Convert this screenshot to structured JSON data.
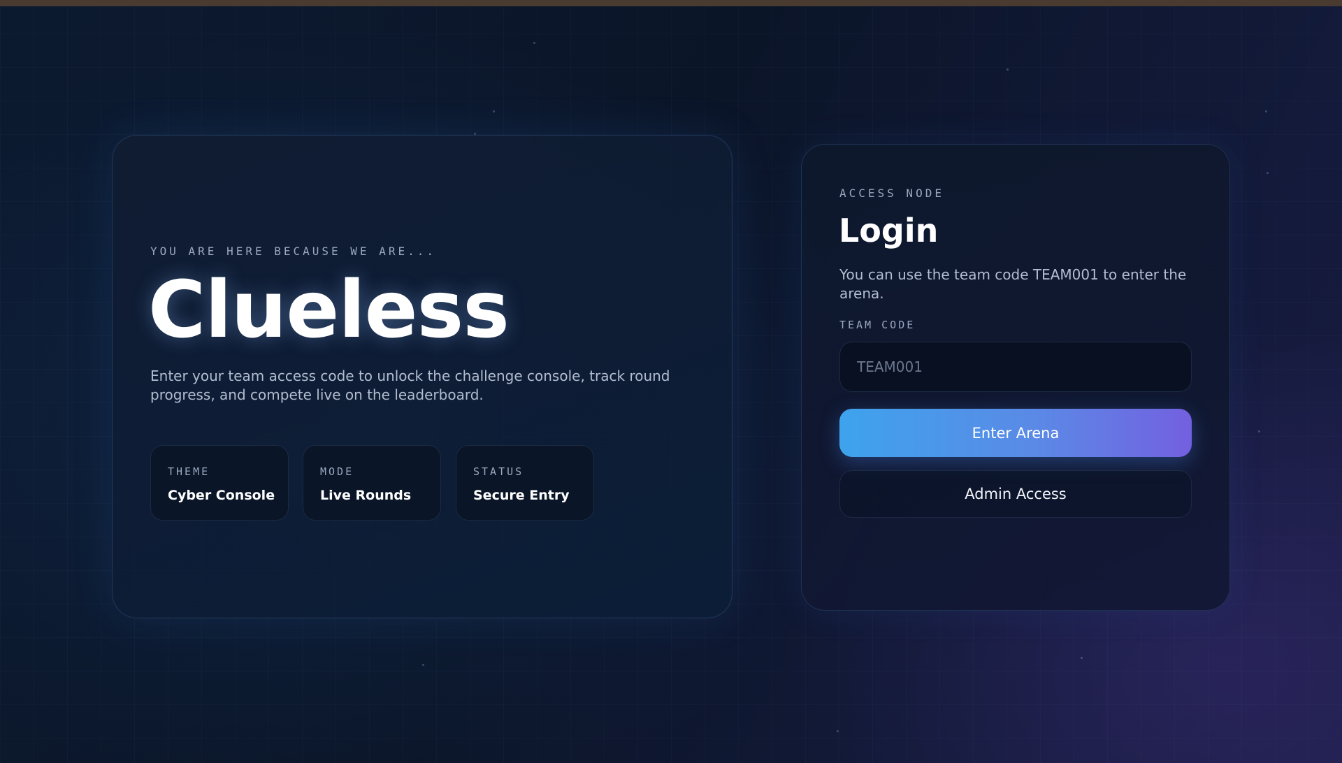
{
  "hero": {
    "kicker": "YOU ARE HERE BECAUSE WE ARE...",
    "title": "Clueless",
    "description": "Enter your team access code to unlock the challenge console, track round progress, and compete live on the leaderboard.",
    "tiles": [
      {
        "label": "THEME",
        "value": "Cyber Console"
      },
      {
        "label": "MODE",
        "value": "Live Rounds"
      },
      {
        "label": "STATUS",
        "value": "Secure Entry"
      }
    ]
  },
  "login": {
    "kicker": "ACCESS NODE",
    "title": "Login",
    "hint": "You can use the team code TEAM001 to enter the arena.",
    "field_label": "TEAM CODE",
    "input_value": "",
    "input_placeholder": "TEAM001",
    "enter_label": "Enter Arena",
    "admin_label": "Admin Access"
  },
  "colors": {
    "accent_start": "#3ea3ec",
    "accent_end": "#7360e0",
    "background": "#0b1528",
    "top_bar": "#4a3b30"
  }
}
